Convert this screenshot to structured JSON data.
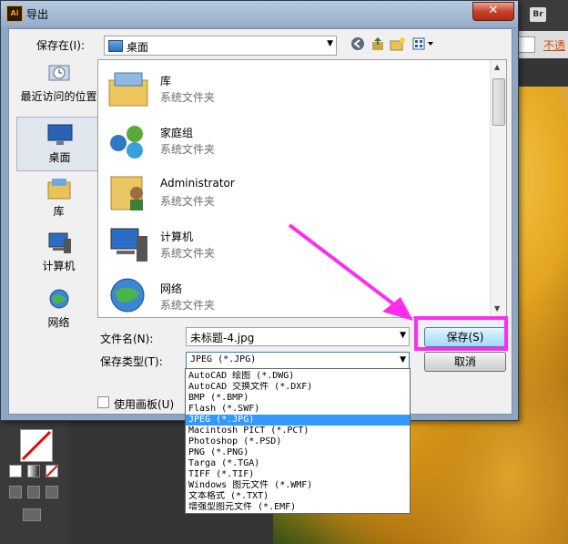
{
  "dialog": {
    "title": "导出",
    "app_icon_text": "Ai",
    "close_glyph": "✕"
  },
  "save_in": {
    "label": "保存在(I):",
    "value": "桌面"
  },
  "toolbar_icons": [
    "back-icon",
    "up-folder-icon",
    "new-folder-icon",
    "view-menu-icon"
  ],
  "places": [
    {
      "label": "最近访问的位置",
      "icon": "recent-places-icon"
    },
    {
      "label": "桌面",
      "icon": "desktop-icon",
      "selected": true
    },
    {
      "label": "库",
      "icon": "library-icon"
    },
    {
      "label": "计算机",
      "icon": "computer-icon"
    },
    {
      "label": "网络",
      "icon": "network-icon"
    }
  ],
  "files": [
    {
      "name": "库",
      "type": "系统文件夹",
      "icon": "library-icon"
    },
    {
      "name": "家庭组",
      "type": "系统文件夹",
      "icon": "homegroup-icon"
    },
    {
      "name": "Administrator",
      "type": "系统文件夹",
      "icon": "user-folder-icon"
    },
    {
      "name": "计算机",
      "type": "系统文件夹",
      "icon": "computer-icon"
    },
    {
      "name": "网络",
      "type": "系统文件夹",
      "icon": "network-icon"
    }
  ],
  "filename": {
    "label": "文件名(N):",
    "value": "未标题-4.jpg"
  },
  "filetype": {
    "label": "保存类型(T):",
    "value": "JPEG (*.JPG)",
    "options": [
      "AutoCAD 绘图 (*.DWG)",
      "AutoCAD 交换文件 (*.DXF)",
      "BMP (*.BMP)",
      "Flash (*.SWF)",
      "JPEG (*.JPG)",
      "Macintosh PICT (*.PCT)",
      "Photoshop (*.PSD)",
      "PNG (*.PNG)",
      "Targa (*.TGA)",
      "TIFF (*.TIF)",
      "Windows 图元文件 (*.WMF)",
      "文本格式 (*.TXT)",
      "增强型图元文件 (*.EMF)"
    ],
    "selected_index": 4
  },
  "buttons": {
    "save": "保存(S)",
    "cancel": "取消"
  },
  "artboard_checkbox": {
    "label": "使用画板(U)",
    "checked": false
  },
  "background_app": {
    "bridge_button": "Br",
    "opacity_link": "不透"
  },
  "colors": {
    "highlight": "#ff2cf0",
    "selection": "#3399ff"
  }
}
